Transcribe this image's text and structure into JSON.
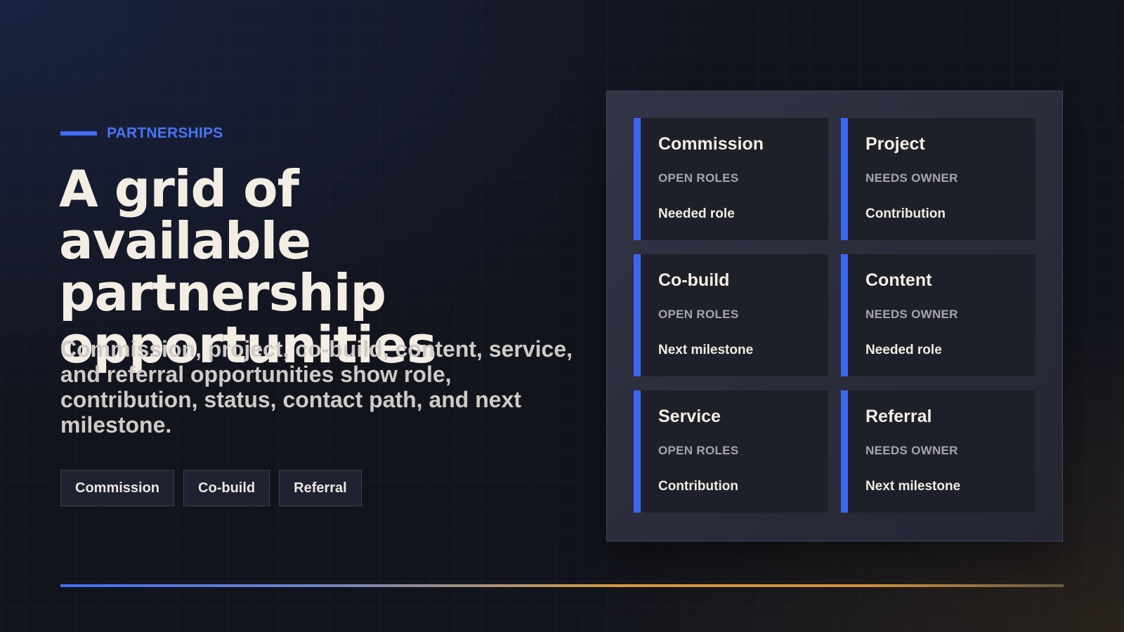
{
  "eyebrow": "PARTNERSHIPS",
  "headline": "A grid of available partnership opportunities",
  "description": "Commission, project, co-build, content, service, and referral opportunities show role, contribution, status, contact path, and next milestone.",
  "tags": [
    "Commission",
    "Co-build",
    "Referral"
  ],
  "cards": [
    {
      "title": "Commission",
      "status": "OPEN ROLES",
      "detail": "Needed role"
    },
    {
      "title": "Project",
      "status": "NEEDS OWNER",
      "detail": "Contribution"
    },
    {
      "title": "Co-build",
      "status": "OPEN ROLES",
      "detail": "Next milestone"
    },
    {
      "title": "Content",
      "status": "NEEDS OWNER",
      "detail": "Needed role"
    },
    {
      "title": "Service",
      "status": "OPEN ROLES",
      "detail": "Contribution"
    },
    {
      "title": "Referral",
      "status": "NEEDS OWNER",
      "detail": "Next milestone"
    }
  ],
  "colors": {
    "accent": "#3f6ef5",
    "background": "#12141d",
    "panel": "#2c2f3e",
    "card": "#1e2029",
    "rule_end": "#d79a3c"
  }
}
